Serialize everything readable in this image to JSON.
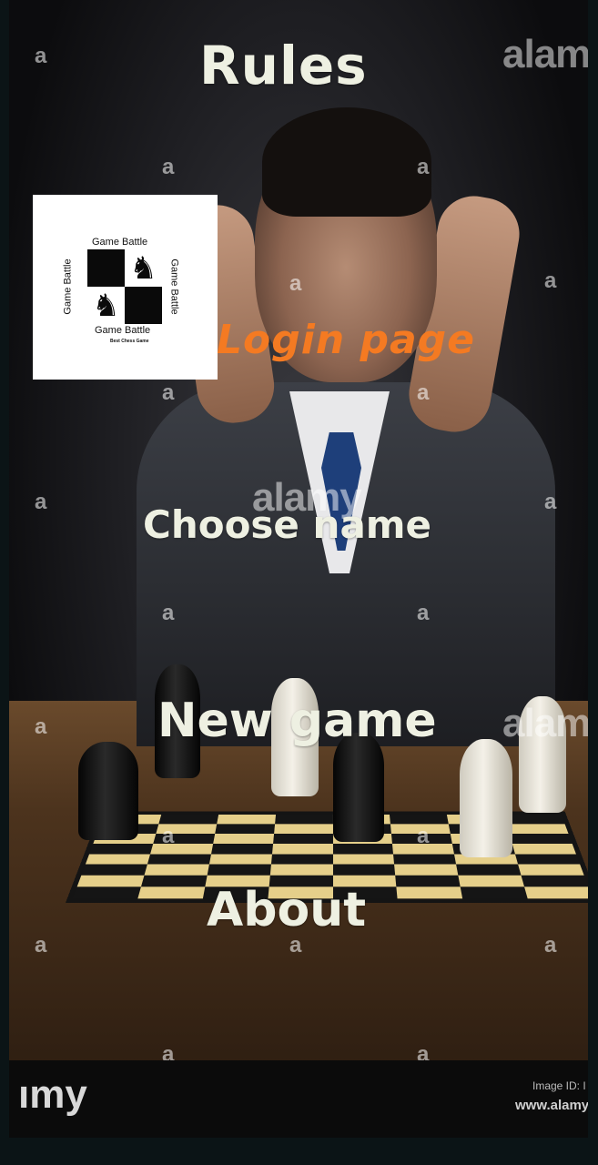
{
  "menu": {
    "rules_label": "Rules",
    "login_label": "Login page",
    "choose_name_label": "Choose name",
    "new_game_label": "New game",
    "about_label": "About"
  },
  "logo": {
    "top_label": "Game Battle",
    "left_label": "Game Battle",
    "right_label": "Game Battle",
    "bottom_label": "Game Battle",
    "tagline": "Best Chess Game",
    "knight_glyph": "♞"
  },
  "watermarks": {
    "small_glyph": "a",
    "brand": "alamy",
    "brand_partial_top": "alamy",
    "brand_partial_mid": "alamy",
    "footer_brand": "ımy",
    "image_id_label": "Image ID: I",
    "url": "www.alamy"
  },
  "colors": {
    "menu_text": "#eef0e2",
    "login_accent": "#f47a22",
    "logo_bg": "#ffffff"
  }
}
